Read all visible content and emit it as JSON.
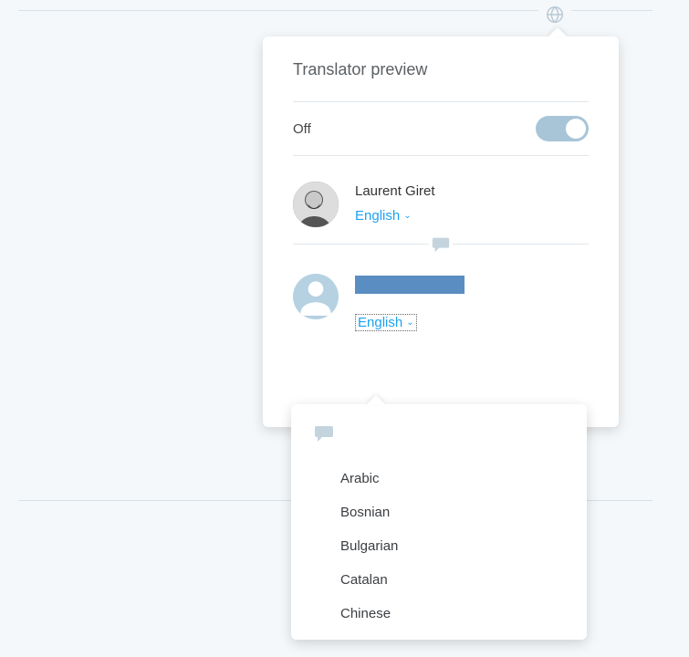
{
  "popover": {
    "title": "Translator preview",
    "toggle": {
      "state_label": "Off",
      "enabled": false
    }
  },
  "people": {
    "primary": {
      "name": "Laurent Giret",
      "language": "English"
    },
    "secondary": {
      "language": "English"
    }
  },
  "language_dropdown": {
    "options": [
      "Arabic",
      "Bosnian",
      "Bulgarian",
      "Catalan",
      "Chinese"
    ]
  },
  "colors": {
    "accent": "#1da1f2",
    "switch_track": "#a8c5d8"
  }
}
